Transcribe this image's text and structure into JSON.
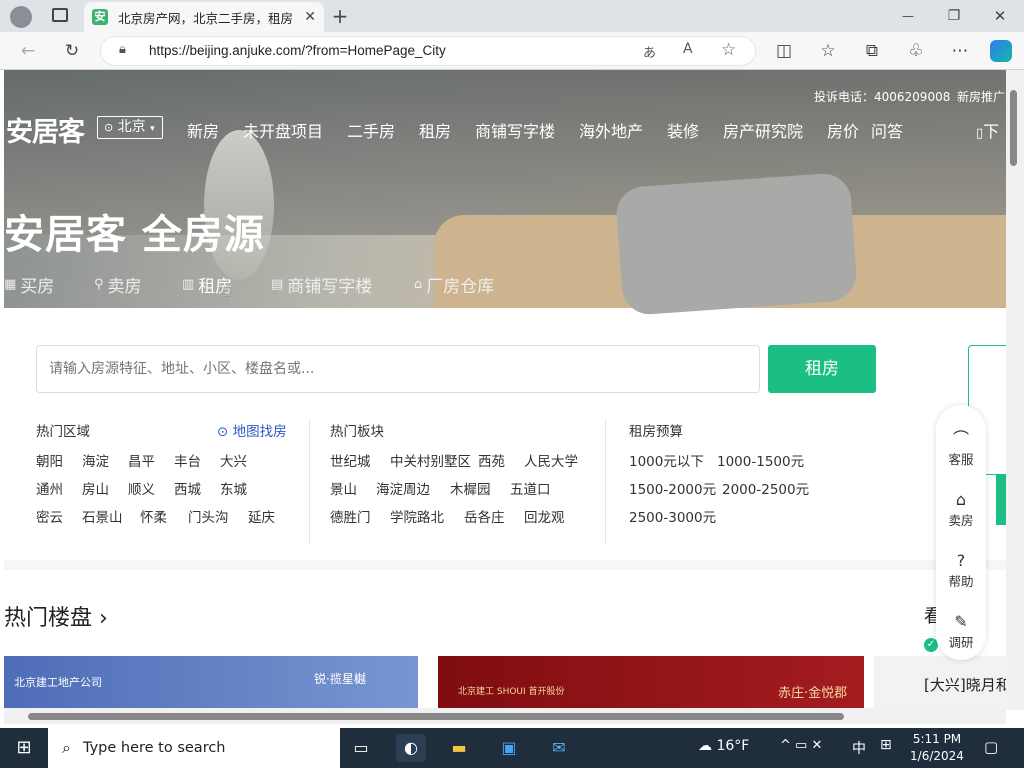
{
  "browser": {
    "tab_title": "北京房产网，北京二手房，租房",
    "url": "https://beijing.anjuke.com/?from=HomePage_City",
    "tab_favicon": "安",
    "new_tab": "+",
    "minimize": "—",
    "restore": "❐",
    "close": "✕"
  },
  "header": {
    "logo": "安居客",
    "city": "北京",
    "phone": "投诉电话：4006209008",
    "promo": "新房推广",
    "download": "下",
    "nav": [
      "新房",
      "未开盘项目",
      "二手房",
      "租房",
      "商铺写字楼",
      "海外地产",
      "装修",
      "房产研究院",
      "房价",
      "问答"
    ]
  },
  "hero": {
    "headline": "安居客 全房源",
    "tabs": [
      "买房",
      "卖房",
      "租房",
      "商铺写字楼",
      "厂房仓库"
    ]
  },
  "search": {
    "placeholder": "请输入房源特征、地址、小区、楼盘名或...",
    "button": "租房"
  },
  "filters": {
    "hot_areas_title": "热门区域",
    "map_find": "地图找房",
    "hot_areas": [
      [
        "朝阳",
        "海淀",
        "昌平",
        "丰台",
        "大兴"
      ],
      [
        "通州",
        "房山",
        "顺义",
        "西城",
        "东城"
      ],
      [
        "密云",
        "石景山",
        "怀柔",
        "门头沟",
        "延庆"
      ]
    ],
    "hot_blocks_title": "热门板块",
    "hot_blocks": [
      [
        "世纪城",
        "中关村别墅区",
        "西苑",
        "人民大学"
      ],
      [
        "景山",
        "海淀周边",
        "木樨园",
        "五道口"
      ],
      [
        "德胜门",
        "学院路北",
        "岳各庄",
        "回龙观"
      ]
    ],
    "budget_title": "租房预算",
    "budgets": [
      [
        "1000元以下",
        "1000-1500元"
      ],
      [
        "1500-2000元",
        "2000-2500元"
      ],
      [
        "2500-3000元"
      ]
    ]
  },
  "sections": {
    "hot_estates": "热门楼盘 ›",
    "kan": "看",
    "news_line": "[大兴]晓月和",
    "banner1_left": "北京建工地产公司",
    "banner1_right": "锐·揽星樾",
    "banner2_left": "北京建工 SHOUI 首开股份",
    "banner2_right": "赤庄·金悦郡"
  },
  "side": [
    {
      "label": "客服",
      "icon": "headset-icon"
    },
    {
      "label": "卖房",
      "icon": "home-icon"
    },
    {
      "label": "帮助",
      "icon": "help-icon"
    },
    {
      "label": "调研",
      "icon": "survey-icon"
    }
  ],
  "taskbar": {
    "search_placeholder": "Type here to search",
    "temp": "16°F",
    "ime": "中",
    "time": "5:11 PM",
    "date": "1/6/2024"
  },
  "colors": {
    "accent": "#1cbf83",
    "taskbar": "#1f2d3d",
    "link": "#2a57c9"
  }
}
